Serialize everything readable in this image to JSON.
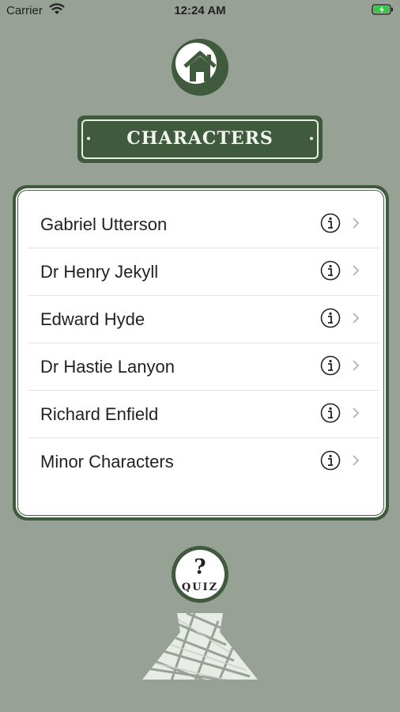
{
  "status_bar": {
    "carrier": "Carrier",
    "time": "12:24 AM",
    "wifi_icon": "wifi-icon",
    "battery_icon": "battery-charging-icon"
  },
  "header": {
    "home_icon": "home-icon",
    "title": "CHARACTERS"
  },
  "characters": [
    {
      "label": "Gabriel Utterson"
    },
    {
      "label": "Dr Henry Jekyll"
    },
    {
      "label": "Edward Hyde"
    },
    {
      "label": "Dr Hastie Lanyon"
    },
    {
      "label": "Richard Enfield"
    },
    {
      "label": "Minor Characters"
    }
  ],
  "quiz": {
    "symbol": "?",
    "label": "QUIZ"
  },
  "colors": {
    "background": "#97a195",
    "accent_green": "#3f5a3d",
    "card": "#ffffff"
  }
}
